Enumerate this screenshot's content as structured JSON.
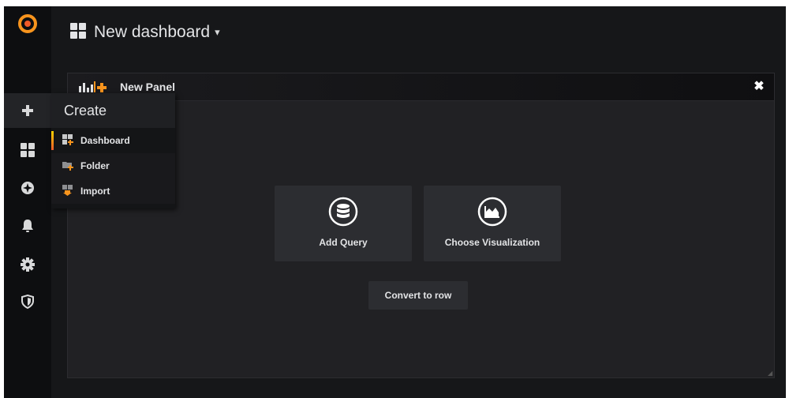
{
  "header": {
    "dashboard_title": "New dashboard",
    "caret": "▾"
  },
  "sidebar": {
    "items": [
      {
        "icon": "grafana-logo-icon"
      },
      {
        "icon": "plus-icon"
      },
      {
        "icon": "dashboards-grid-icon"
      },
      {
        "icon": "compass-icon"
      },
      {
        "icon": "bell-icon"
      },
      {
        "icon": "gear-icon"
      },
      {
        "icon": "shield-icon"
      }
    ]
  },
  "create_menu": {
    "title": "Create",
    "items": [
      {
        "label": "Dashboard",
        "icon": "dashboard-add-icon"
      },
      {
        "label": "Folder",
        "icon": "folder-add-icon"
      },
      {
        "label": "Import",
        "icon": "import-icon"
      }
    ]
  },
  "panel": {
    "title": "New Panel",
    "close": "✖",
    "actions": {
      "add_query": "Add Query",
      "choose_visualization": "Choose Visualization",
      "convert_to_row": "Convert to row"
    }
  },
  "colors": {
    "accent_orange": "#f7941d",
    "background": "#161719",
    "panel": "#212124",
    "card": "#2c2d31"
  }
}
